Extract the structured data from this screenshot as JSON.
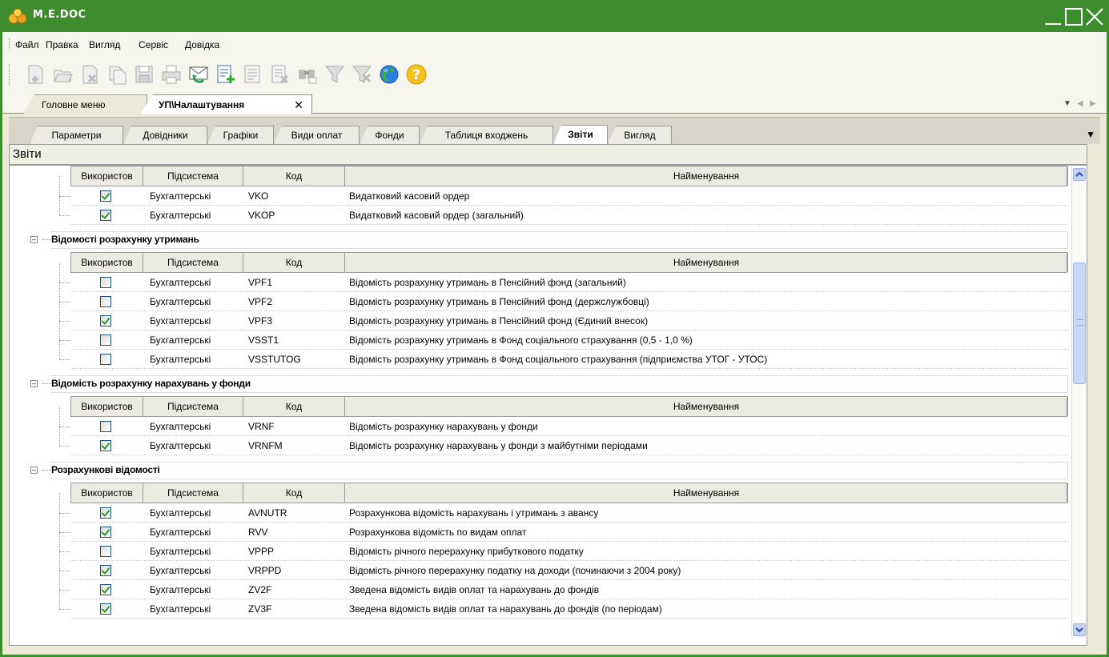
{
  "app": {
    "title": "M.E.DOC"
  },
  "menu": [
    "Файл",
    "Правка",
    "Вигляд",
    "Сервіс",
    "Довідка"
  ],
  "toolbar": [
    {
      "icon": "new-document-icon"
    },
    {
      "icon": "open-document-icon"
    },
    {
      "icon": "delete-document-icon"
    },
    {
      "icon": "copy-document-icon"
    },
    {
      "icon": "save-icon"
    },
    {
      "icon": "print-icon"
    },
    {
      "icon": "refresh-mail-icon"
    },
    {
      "icon": "add-list-icon"
    },
    {
      "icon": "list-icon"
    },
    {
      "icon": "remove-list-icon"
    },
    {
      "icon": "find-icon"
    },
    {
      "icon": "filter-icon"
    },
    {
      "icon": "clear-filter-icon"
    },
    {
      "icon": "globe-icon"
    },
    {
      "icon": "help-icon"
    }
  ],
  "doc_tabs": [
    {
      "label": "Головне меню",
      "active": false
    },
    {
      "label": "УП\\Налаштування",
      "active": true
    }
  ],
  "sub_tabs": [
    {
      "label": "Параметри"
    },
    {
      "label": "Довідники"
    },
    {
      "label": "Графіки"
    },
    {
      "label": "Види оплат"
    },
    {
      "label": "Фонди"
    },
    {
      "label": "Таблиця входжень"
    },
    {
      "label": "Звіти",
      "active": true
    },
    {
      "label": "Вигляд"
    }
  ],
  "section_title": "Звіти",
  "columns": [
    "Використов",
    "Підсистема",
    "Код",
    "Найменування"
  ],
  "groups": [
    {
      "title": "",
      "rows": [
        {
          "used": true,
          "subsystem": "Бухгалтерські",
          "code": "VKO",
          "name": "Видатковий касовий ордер"
        },
        {
          "used": true,
          "subsystem": "Бухгалтерські",
          "code": "VKOP",
          "name": "Видатковий касовий ордер (загальний)"
        }
      ]
    },
    {
      "title": "Відомості розрахунку утримань",
      "rows": [
        {
          "used": false,
          "subsystem": "Бухгалтерські",
          "code": "VPF1",
          "name": "Відомість розрахунку утримань в Пенсійний фонд (загальний)"
        },
        {
          "used": false,
          "subsystem": "Бухгалтерські",
          "code": "VPF2",
          "name": "Відомість розрахунку утримань в Пенсійний фонд (держслужбовці)"
        },
        {
          "used": true,
          "subsystem": "Бухгалтерські",
          "code": "VPF3",
          "name": "Відомість розрахунку утримань в Пенсійний фонд (Єдиний внесок)"
        },
        {
          "used": false,
          "subsystem": "Бухгалтерські",
          "code": "VSST1",
          "name": "Відомість розрахунку утримань в Фонд соціального страхування (0,5 - 1,0 %)"
        },
        {
          "used": false,
          "subsystem": "Бухгалтерські",
          "code": "VSSTUTOG",
          "name": "Відомість розрахунку утримань в Фонд соціального страхування (підприємства УТОГ - УТОС)"
        }
      ]
    },
    {
      "title": "Відомість розрахунку нарахувань у фонди",
      "rows": [
        {
          "used": false,
          "subsystem": "Бухгалтерські",
          "code": "VRNF",
          "name": "Відомість розрахунку нарахувань у фонди"
        },
        {
          "used": true,
          "subsystem": "Бухгалтерські",
          "code": "VRNFM",
          "name": "Відомість розрахунку нарахувань у фонди з майбутніми періодами"
        }
      ]
    },
    {
      "title": "Розрахункові відомості",
      "rows": [
        {
          "used": true,
          "subsystem": "Бухгалтерські",
          "code": "AVNUTR",
          "name": "Розрахункова відомість нарахувань і утримань з авансу"
        },
        {
          "used": true,
          "subsystem": "Бухгалтерські",
          "code": "RVV",
          "name": "Розрахункова відомість по видам оплат"
        },
        {
          "used": false,
          "subsystem": "Бухгалтерські",
          "code": "VPPP",
          "name": "Відомість річного перерахунку прибуткового податку"
        },
        {
          "used": true,
          "subsystem": "Бухгалтерські",
          "code": "VRPPD",
          "name": "Відомість річного перерахунку податку на доходи (починаючи з 2004 року)"
        },
        {
          "used": true,
          "subsystem": "Бухгалтерські",
          "code": "ZV2F",
          "name": "Зведена відомість видів оплат та нарахувань до фондів"
        },
        {
          "used": true,
          "subsystem": "Бухгалтерські",
          "code": "ZV3F",
          "name": "Зведена відомість видів оплат та нарахувань до фондів (по періодам)"
        }
      ]
    }
  ]
}
